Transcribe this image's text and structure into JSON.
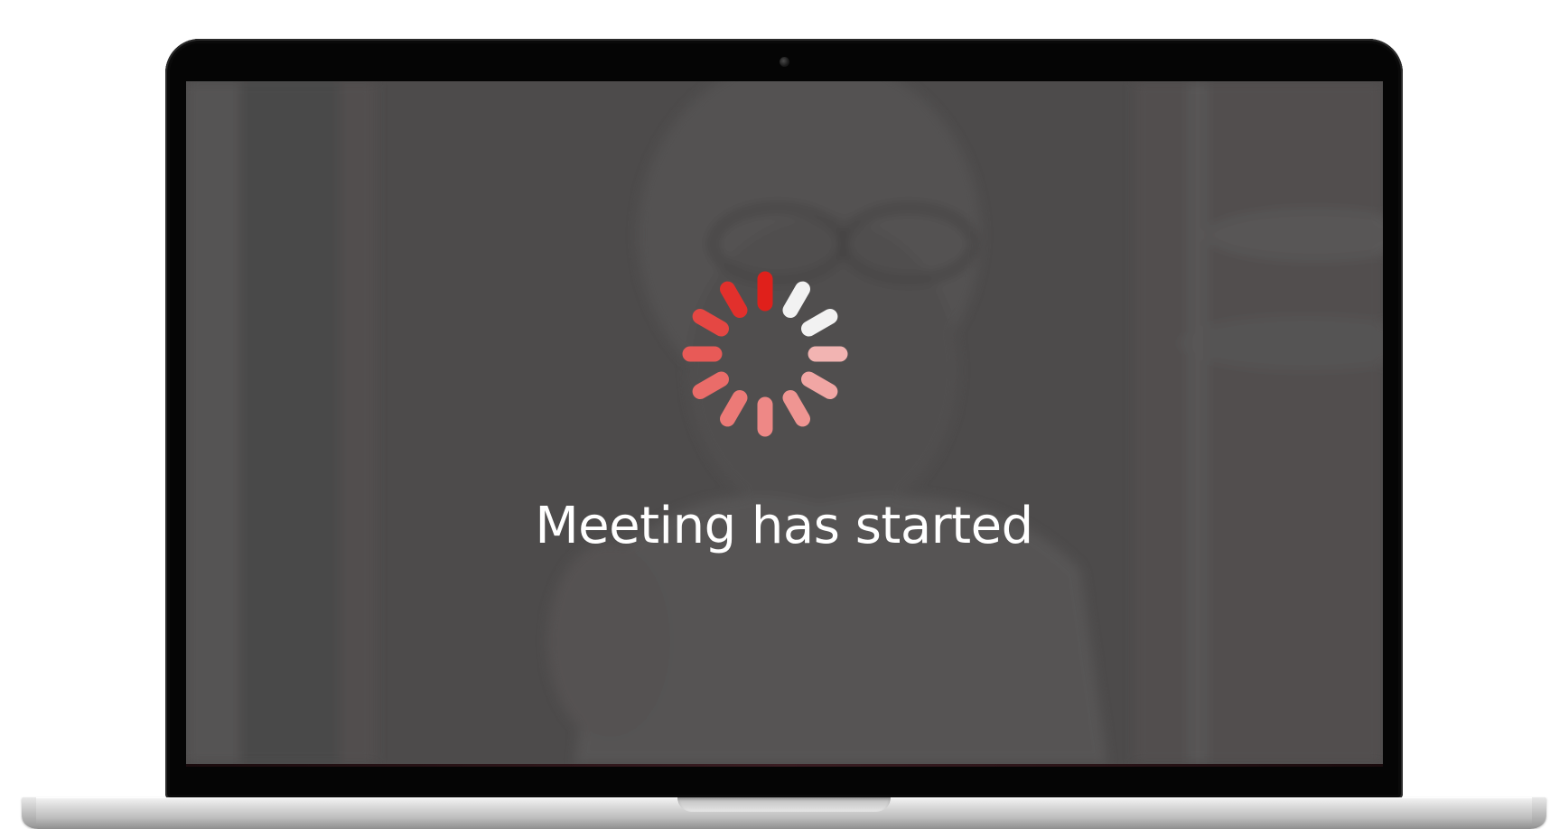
{
  "device": {
    "type": "laptop"
  },
  "screen": {
    "status_text": "Meeting has started",
    "spinner_icon": "loading-spinner-icon"
  },
  "colors": {
    "spinner_active": "#e0201b",
    "spinner_fade": "#f09a98",
    "spinner_dim": "#f2f2f2",
    "overlay": "#4e4c4c"
  }
}
